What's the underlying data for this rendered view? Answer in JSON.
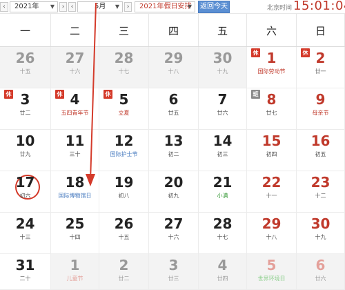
{
  "toolbar": {
    "prev_year": "‹",
    "year_value": "2021年",
    "next_year": "›",
    "prev_month": "‹",
    "month_value": "5月",
    "next_month": "›",
    "holiday_value": "2021年假日安排",
    "today_label": "返回今天",
    "beijing_time_label": "北京时间",
    "time": "15:01:04"
  },
  "weekdays": [
    "一",
    "二",
    "三",
    "四",
    "五",
    "六",
    "日"
  ],
  "weeks": [
    [
      {
        "day": "26",
        "sub": "十五",
        "other": true
      },
      {
        "day": "27",
        "sub": "十六",
        "other": true
      },
      {
        "day": "28",
        "sub": "十七",
        "other": true
      },
      {
        "day": "29",
        "sub": "十八",
        "other": true
      },
      {
        "day": "30",
        "sub": "十九",
        "other": true
      },
      {
        "day": "1",
        "sub": "国际劳动节",
        "subColor": "red",
        "weekend": true,
        "badge": "休"
      },
      {
        "day": "2",
        "sub": "廿一",
        "weekend": true,
        "badge": "休"
      }
    ],
    [
      {
        "day": "3",
        "sub": "廿二",
        "badge": "休"
      },
      {
        "day": "4",
        "sub": "五四青年节",
        "subColor": "red",
        "badge": "休"
      },
      {
        "day": "5",
        "sub": "立夏",
        "subColor": "red",
        "badge": "休"
      },
      {
        "day": "6",
        "sub": "廿五"
      },
      {
        "day": "7",
        "sub": "廿六"
      },
      {
        "day": "8",
        "sub": "廿七",
        "weekend": true,
        "badge": "班",
        "badgeType": "work"
      },
      {
        "day": "9",
        "sub": "母亲节",
        "subColor": "red",
        "weekend": true
      }
    ],
    [
      {
        "day": "10",
        "sub": "廿九"
      },
      {
        "day": "11",
        "sub": "三十"
      },
      {
        "day": "12",
        "sub": "国际护士节",
        "subColor": "blue"
      },
      {
        "day": "13",
        "sub": "初二"
      },
      {
        "day": "14",
        "sub": "初三"
      },
      {
        "day": "15",
        "sub": "初四",
        "weekend": true
      },
      {
        "day": "16",
        "sub": "初五",
        "weekend": true
      }
    ],
    [
      {
        "day": "17",
        "sub": "初六",
        "today": true
      },
      {
        "day": "18",
        "sub": "国际博物馆日",
        "subColor": "blue"
      },
      {
        "day": "19",
        "sub": "初八"
      },
      {
        "day": "20",
        "sub": "初九"
      },
      {
        "day": "21",
        "sub": "小满",
        "subColor": "green"
      },
      {
        "day": "22",
        "sub": "十一",
        "weekend": true
      },
      {
        "day": "23",
        "sub": "十二",
        "weekend": true
      }
    ],
    [
      {
        "day": "24",
        "sub": "十三"
      },
      {
        "day": "25",
        "sub": "十四"
      },
      {
        "day": "26",
        "sub": "十五"
      },
      {
        "day": "27",
        "sub": "十六"
      },
      {
        "day": "28",
        "sub": "十七"
      },
      {
        "day": "29",
        "sub": "十八",
        "weekend": true
      },
      {
        "day": "30",
        "sub": "十九",
        "weekend": true
      }
    ],
    [
      {
        "day": "31",
        "sub": "二十"
      },
      {
        "day": "1",
        "sub": "儿童节",
        "subColor": "red",
        "other": true
      },
      {
        "day": "2",
        "sub": "廿二",
        "other": true
      },
      {
        "day": "3",
        "sub": "廿三",
        "other": true
      },
      {
        "day": "4",
        "sub": "廿四",
        "other": true
      },
      {
        "day": "5",
        "sub": "世界环境日",
        "subColor": "green",
        "other": true,
        "weekend": true
      },
      {
        "day": "6",
        "sub": "廿六",
        "other": true,
        "weekend": true
      }
    ]
  ],
  "colors": {
    "weekend_red": "#c0392b",
    "holiday_badge": "#d43a2a",
    "work_badge": "#8a8a8a",
    "today_button": "#5b8fd3",
    "arrow": "#d43a2a",
    "festival_blue": "#4a7cc0",
    "solar_term_green": "#3f9d3f"
  }
}
